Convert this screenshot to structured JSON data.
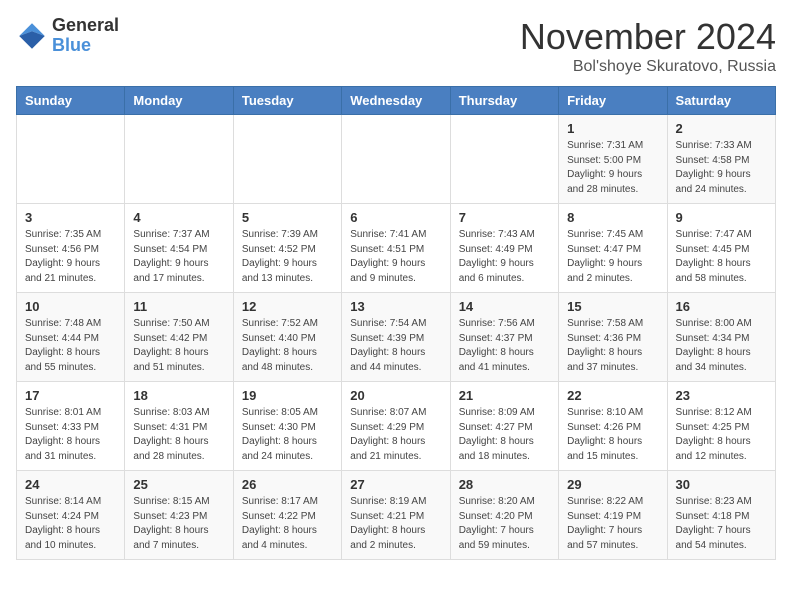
{
  "header": {
    "logo_general": "General",
    "logo_blue": "Blue",
    "month_title": "November 2024",
    "location": "Bol'shoye Skuratovo, Russia"
  },
  "weekdays": [
    "Sunday",
    "Monday",
    "Tuesday",
    "Wednesday",
    "Thursday",
    "Friday",
    "Saturday"
  ],
  "weeks": [
    [
      {
        "day": "",
        "detail": ""
      },
      {
        "day": "",
        "detail": ""
      },
      {
        "day": "",
        "detail": ""
      },
      {
        "day": "",
        "detail": ""
      },
      {
        "day": "",
        "detail": ""
      },
      {
        "day": "1",
        "detail": "Sunrise: 7:31 AM\nSunset: 5:00 PM\nDaylight: 9 hours and 28 minutes."
      },
      {
        "day": "2",
        "detail": "Sunrise: 7:33 AM\nSunset: 4:58 PM\nDaylight: 9 hours and 24 minutes."
      }
    ],
    [
      {
        "day": "3",
        "detail": "Sunrise: 7:35 AM\nSunset: 4:56 PM\nDaylight: 9 hours and 21 minutes."
      },
      {
        "day": "4",
        "detail": "Sunrise: 7:37 AM\nSunset: 4:54 PM\nDaylight: 9 hours and 17 minutes."
      },
      {
        "day": "5",
        "detail": "Sunrise: 7:39 AM\nSunset: 4:52 PM\nDaylight: 9 hours and 13 minutes."
      },
      {
        "day": "6",
        "detail": "Sunrise: 7:41 AM\nSunset: 4:51 PM\nDaylight: 9 hours and 9 minutes."
      },
      {
        "day": "7",
        "detail": "Sunrise: 7:43 AM\nSunset: 4:49 PM\nDaylight: 9 hours and 6 minutes."
      },
      {
        "day": "8",
        "detail": "Sunrise: 7:45 AM\nSunset: 4:47 PM\nDaylight: 9 hours and 2 minutes."
      },
      {
        "day": "9",
        "detail": "Sunrise: 7:47 AM\nSunset: 4:45 PM\nDaylight: 8 hours and 58 minutes."
      }
    ],
    [
      {
        "day": "10",
        "detail": "Sunrise: 7:48 AM\nSunset: 4:44 PM\nDaylight: 8 hours and 55 minutes."
      },
      {
        "day": "11",
        "detail": "Sunrise: 7:50 AM\nSunset: 4:42 PM\nDaylight: 8 hours and 51 minutes."
      },
      {
        "day": "12",
        "detail": "Sunrise: 7:52 AM\nSunset: 4:40 PM\nDaylight: 8 hours and 48 minutes."
      },
      {
        "day": "13",
        "detail": "Sunrise: 7:54 AM\nSunset: 4:39 PM\nDaylight: 8 hours and 44 minutes."
      },
      {
        "day": "14",
        "detail": "Sunrise: 7:56 AM\nSunset: 4:37 PM\nDaylight: 8 hours and 41 minutes."
      },
      {
        "day": "15",
        "detail": "Sunrise: 7:58 AM\nSunset: 4:36 PM\nDaylight: 8 hours and 37 minutes."
      },
      {
        "day": "16",
        "detail": "Sunrise: 8:00 AM\nSunset: 4:34 PM\nDaylight: 8 hours and 34 minutes."
      }
    ],
    [
      {
        "day": "17",
        "detail": "Sunrise: 8:01 AM\nSunset: 4:33 PM\nDaylight: 8 hours and 31 minutes."
      },
      {
        "day": "18",
        "detail": "Sunrise: 8:03 AM\nSunset: 4:31 PM\nDaylight: 8 hours and 28 minutes."
      },
      {
        "day": "19",
        "detail": "Sunrise: 8:05 AM\nSunset: 4:30 PM\nDaylight: 8 hours and 24 minutes."
      },
      {
        "day": "20",
        "detail": "Sunrise: 8:07 AM\nSunset: 4:29 PM\nDaylight: 8 hours and 21 minutes."
      },
      {
        "day": "21",
        "detail": "Sunrise: 8:09 AM\nSunset: 4:27 PM\nDaylight: 8 hours and 18 minutes."
      },
      {
        "day": "22",
        "detail": "Sunrise: 8:10 AM\nSunset: 4:26 PM\nDaylight: 8 hours and 15 minutes."
      },
      {
        "day": "23",
        "detail": "Sunrise: 8:12 AM\nSunset: 4:25 PM\nDaylight: 8 hours and 12 minutes."
      }
    ],
    [
      {
        "day": "24",
        "detail": "Sunrise: 8:14 AM\nSunset: 4:24 PM\nDaylight: 8 hours and 10 minutes."
      },
      {
        "day": "25",
        "detail": "Sunrise: 8:15 AM\nSunset: 4:23 PM\nDaylight: 8 hours and 7 minutes."
      },
      {
        "day": "26",
        "detail": "Sunrise: 8:17 AM\nSunset: 4:22 PM\nDaylight: 8 hours and 4 minutes."
      },
      {
        "day": "27",
        "detail": "Sunrise: 8:19 AM\nSunset: 4:21 PM\nDaylight: 8 hours and 2 minutes."
      },
      {
        "day": "28",
        "detail": "Sunrise: 8:20 AM\nSunset: 4:20 PM\nDaylight: 7 hours and 59 minutes."
      },
      {
        "day": "29",
        "detail": "Sunrise: 8:22 AM\nSunset: 4:19 PM\nDaylight: 7 hours and 57 minutes."
      },
      {
        "day": "30",
        "detail": "Sunrise: 8:23 AM\nSunset: 4:18 PM\nDaylight: 7 hours and 54 minutes."
      }
    ]
  ]
}
